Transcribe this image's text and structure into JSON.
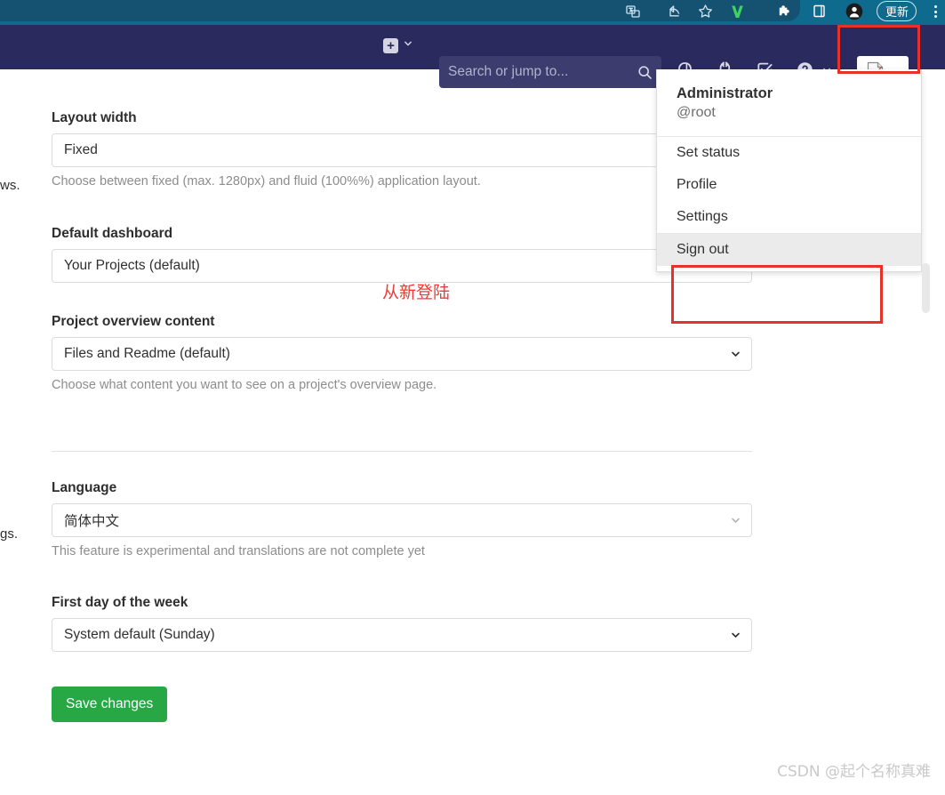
{
  "browser": {
    "icons": [
      {
        "name": "translate-icon"
      },
      {
        "name": "share-icon"
      },
      {
        "name": "bookmark-star-icon"
      },
      {
        "name": "vimium-extension-icon"
      },
      {
        "name": "extensions-puzzle-icon"
      },
      {
        "name": "side-panel-icon"
      },
      {
        "name": "browser-profile-avatar-icon"
      }
    ],
    "update_label": "更新",
    "menu_icon": "kebab-menu-icon",
    "colors": {
      "chrome_bg": "#0f6b8e",
      "omnibox_bg": "#155272"
    }
  },
  "navbar": {
    "create_new_label": "+",
    "create_new_icon": "plus-square-icon",
    "create_new_caret_icon": "chevron-down-icon",
    "search": {
      "placeholder": "Search or jump to...",
      "value": "",
      "icon": "search-icon"
    },
    "items": [
      {
        "name": "issues-icon",
        "title": "Issues"
      },
      {
        "name": "merge-requests-icon",
        "title": "Merge requests"
      },
      {
        "name": "todos-icon",
        "title": "To-Do List"
      },
      {
        "name": "help-icon",
        "title": "Help"
      }
    ],
    "help_caret_icon": "chevron-down-icon",
    "avatar_icon": "broken-image-avatar-icon",
    "avatar_caret_icon": "chevron-down-icon",
    "bg_color": "#2a2a5e"
  },
  "user_menu": {
    "name": "Administrator",
    "handle": "@root",
    "items": [
      {
        "label": "Set status",
        "active": false
      },
      {
        "label": "Profile",
        "active": false
      },
      {
        "label": "Settings",
        "active": false
      },
      {
        "label": "Sign out",
        "active": true
      }
    ]
  },
  "page": {
    "left_fragments": {
      "top": "ws.",
      "bottom": "gs."
    },
    "fields": {
      "layout_width": {
        "label": "Layout width",
        "value": "Fixed",
        "help": "Choose between fixed (max. 1280px) and fluid (100%%) application layout."
      },
      "default_dashboard": {
        "label": "Default dashboard",
        "value": "Your Projects (default)",
        "help": ""
      },
      "project_overview_content": {
        "label": "Project overview content",
        "value": "Files and Readme (default)",
        "help": "Choose what content you want to see on a project's overview page."
      },
      "language": {
        "label": "Language",
        "value": "简体中文",
        "help": "This feature is experimental and translations are not complete yet"
      },
      "first_day_of_week": {
        "label": "First day of the week",
        "value": "System default (Sunday)",
        "help": ""
      }
    },
    "save_label": "Save changes",
    "save_color": "#28a745"
  },
  "annotations": {
    "note_text": "从新登陆",
    "note_color": "#ef3b38",
    "box_color": "#e8312b"
  },
  "watermark": "CSDN @起个名称真难"
}
